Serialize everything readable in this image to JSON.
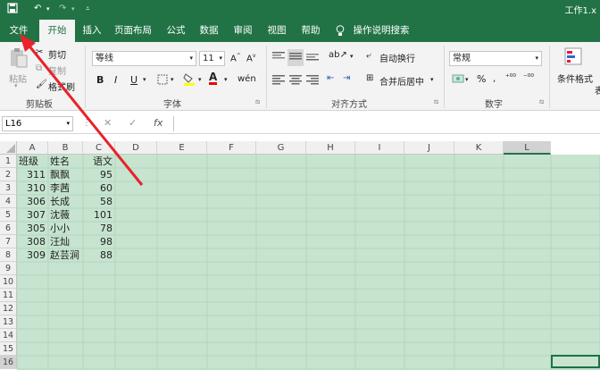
{
  "titlebar": {
    "save_icon": "save-icon",
    "undo_icon": "undo-icon",
    "redo_icon": "redo-icon",
    "customize_icon": "customize-icon",
    "title": "工作1.x"
  },
  "tabs": [
    "文件",
    "开始",
    "插入",
    "页面布局",
    "公式",
    "数据",
    "审阅",
    "视图",
    "帮助",
    "操作说明搜索"
  ],
  "ribbon": {
    "clipboard": {
      "paste": "粘贴",
      "cut": "剪切",
      "copy": "复制",
      "format_painter": "格式刷",
      "label": "剪贴板"
    },
    "font": {
      "name": "等线",
      "size": "11",
      "bold": "B",
      "italic": "I",
      "underline": "U",
      "font_color": "A",
      "label": "字体"
    },
    "alignment": {
      "wrap": "自动换行",
      "merge": "合并后居中",
      "label": "对齐方式"
    },
    "number": {
      "format": "常规",
      "percent": "%",
      "label": "数字"
    },
    "styles": {
      "conditional": "条件格式",
      "extra": "表"
    }
  },
  "formula": {
    "name_box": "L16",
    "cancel": "✕",
    "enter": "✓",
    "fx": "fx",
    "value": ""
  },
  "columns": [
    "A",
    "B",
    "C",
    "D",
    "E",
    "F",
    "G",
    "H",
    "I",
    "J",
    "K",
    "L"
  ],
  "rows": [
    "1",
    "2",
    "3",
    "4",
    "5",
    "6",
    "7",
    "8",
    "9",
    "10",
    "11",
    "12",
    "13",
    "14",
    "15",
    "16"
  ],
  "headers": {
    "a": "班级",
    "b": "姓名",
    "c": "语文"
  },
  "data": [
    {
      "a": "311",
      "b": "飘飘",
      "c": "95"
    },
    {
      "a": "310",
      "b": "李茜",
      "c": "60"
    },
    {
      "a": "306",
      "b": "长成",
      "c": "58"
    },
    {
      "a": "307",
      "b": "沈薇",
      "c": "101"
    },
    {
      "a": "305",
      "b": "小小",
      "c": "78"
    },
    {
      "a": "308",
      "b": "汪灿",
      "c": "98"
    },
    {
      "a": "309",
      "b": "赵芸涧",
      "c": "88"
    }
  ]
}
